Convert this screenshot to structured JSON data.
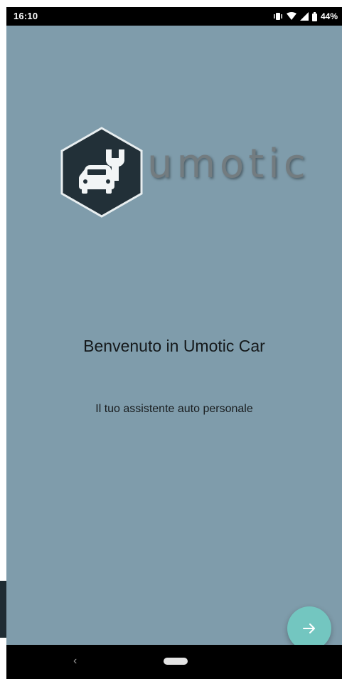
{
  "status_bar": {
    "time": "16:10",
    "battery": "44%",
    "icons": [
      "vibrate-icon",
      "wifi-icon",
      "cellular-signal-icon",
      "battery-icon"
    ]
  },
  "logo": {
    "wordmark": "umotic",
    "icon": "car-wrench-icon"
  },
  "welcome": {
    "title": "Benvenuto in Umotic Car",
    "subtitle": "Il tuo assistente auto personale"
  },
  "next_button": {
    "icon": "arrow-right-icon"
  },
  "nav_bar": {
    "back_icon": "back-chevron-icon",
    "home_icon": "home-pill-icon"
  },
  "colors": {
    "background": "#7f9cab",
    "fab": "#73c6c0",
    "logo_hex": "#223038",
    "wordmark": "#737c80"
  }
}
